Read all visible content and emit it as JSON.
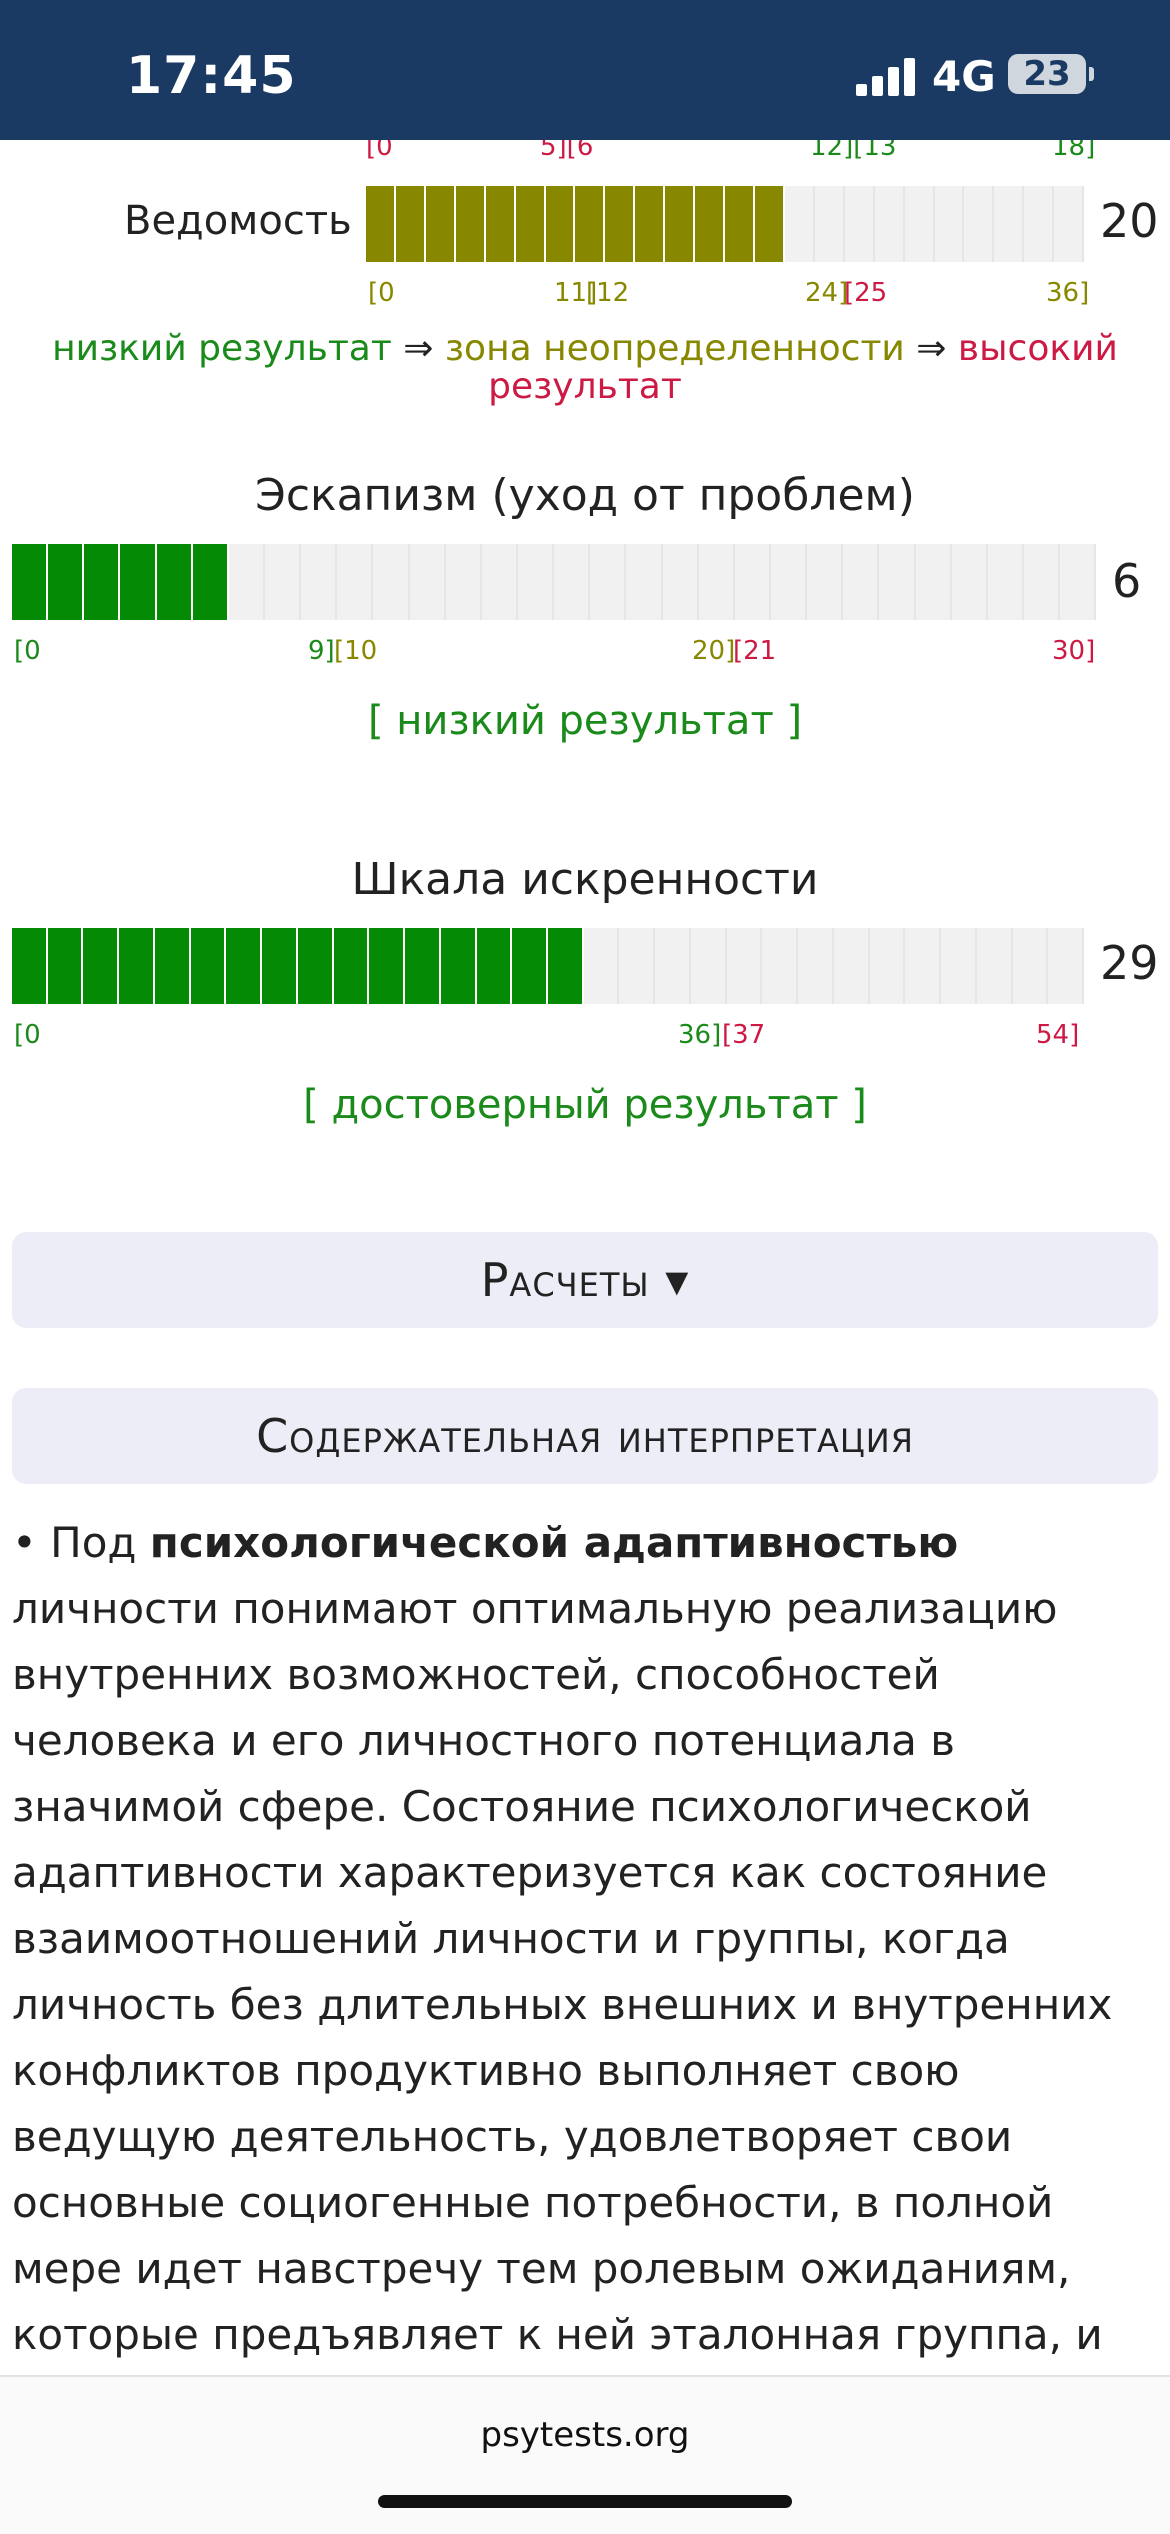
{
  "status_bar": {
    "time": "17:45",
    "network": "4G",
    "battery": "23"
  },
  "vedomost": {
    "top_ticks": {
      "t1": "[0",
      "t2": "5][6",
      "t3": "12][13",
      "t4": "18]"
    },
    "label": "Ведомость",
    "score": "20",
    "segments_total": 24,
    "segments_filled": 14,
    "fill_color": "#878700",
    "ticks": {
      "t1": "[0",
      "t2a": "11]",
      "t2b": "[12",
      "t3a": "24]",
      "t3b": "[25",
      "t4": "36]"
    }
  },
  "legend": {
    "low": "низкий результат",
    "arrow1": " ⇒ ",
    "mid": "зона неопределенности",
    "arrow2": " ⇒ ",
    "high": "высокий результат"
  },
  "escapism": {
    "title": "Эскапизм (уход от проблем)",
    "score": "6",
    "segments_total": 30,
    "segments_filled": 6,
    "fill_color": "#058a05",
    "ticks": {
      "t1": "[0",
      "t2a": "9]",
      "t2b": "[10",
      "t3a": "20]",
      "t3b": "[21",
      "t4": "30]"
    },
    "verdict": "[ низкий результат ]"
  },
  "sincerity": {
    "title": "Шкала искренности",
    "score": "29",
    "segments_total": 30,
    "segments_filled": 16,
    "fill_color": "#058a05",
    "ticks": {
      "t1": "[0",
      "t2a": "36]",
      "t2b": "[37",
      "t3": "54]"
    },
    "verdict": "[ достоверный результат ]"
  },
  "sections": {
    "calc_label": "Расчеты ▾",
    "interpretation_label": "Содержательная интерпретация"
  },
  "body": {
    "bullet_intro": "• Под ",
    "bold_term": "психологической адаптивностью",
    "text": " личности понимают оптимальную реализацию внутренних возможностей, способностей человека и его личностного потенциала в значимой сфере. Состояние психологической адаптивности характеризуется как состояние взаимоотношений личности и группы, когда личность без длительных внешних и внутренних конфликтов продуктивно выполняет свою ведущую деятельность, удовлетворяет свои основные социогенные потребности, в полной мере идет навстречу тем ролевым ожиданиям, которые предъявляет к ней эталонная группа, и"
  },
  "footer": {
    "url": "psytests.org"
  }
}
